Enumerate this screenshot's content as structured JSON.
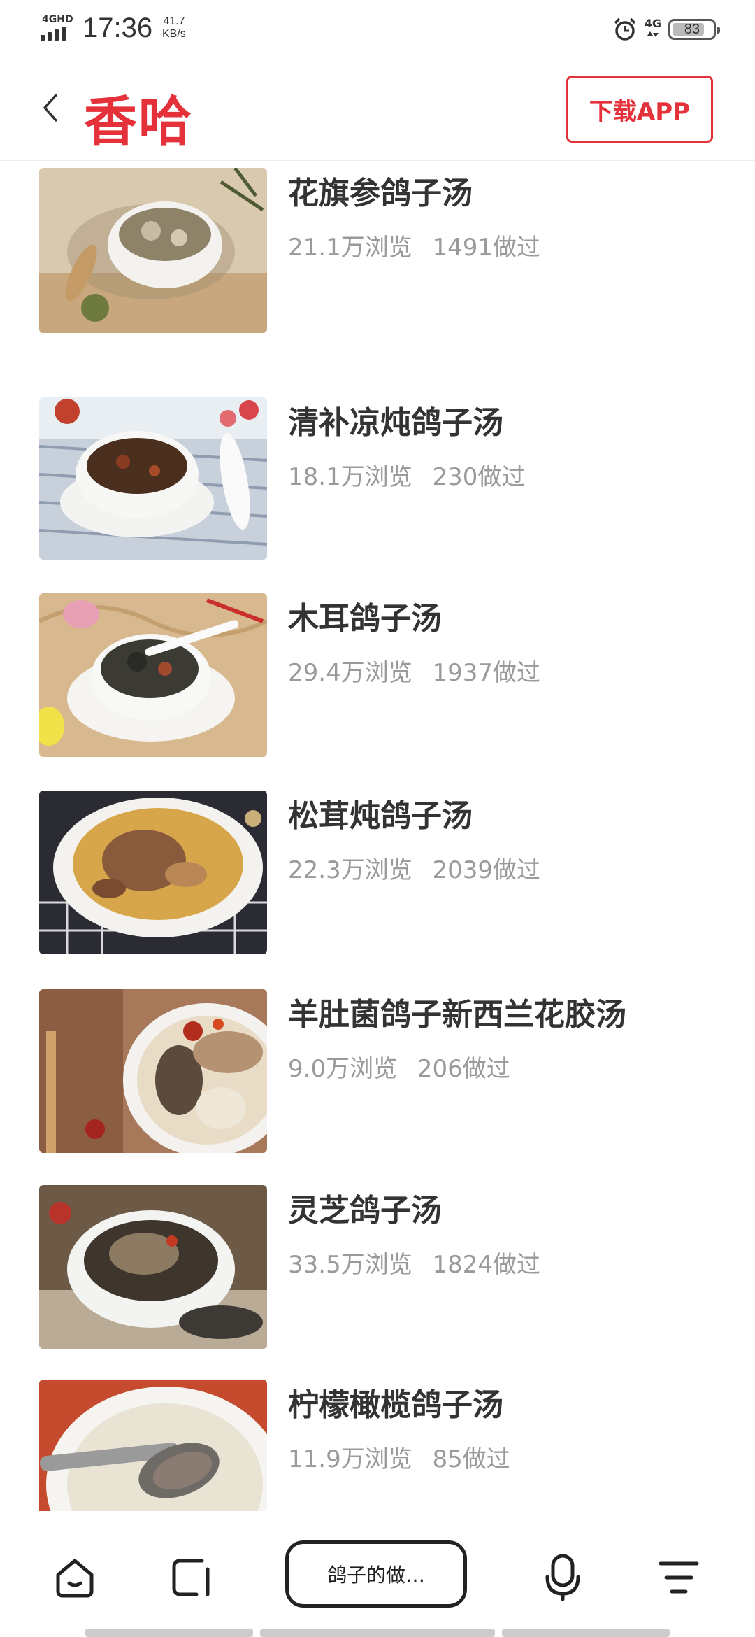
{
  "status_bar": {
    "network": "4GHD",
    "time": "17:36",
    "speed_value": "41.7",
    "speed_unit": "KB/s",
    "right_network": "4G",
    "battery": "83"
  },
  "header": {
    "logo": "香哈",
    "download_label": "下载APP"
  },
  "recipes": [
    {
      "title": "花旗参鸽子汤",
      "views": "21.1万浏览",
      "made": "1491做过"
    },
    {
      "title": "清补凉炖鸽子汤",
      "views": "18.1万浏览",
      "made": "230做过"
    },
    {
      "title": "木耳鸽子汤",
      "views": "29.4万浏览",
      "made": "1937做过"
    },
    {
      "title": "松茸炖鸽子汤",
      "views": "22.3万浏览",
      "made": "2039做过"
    },
    {
      "title": "羊肚菌鸽子新西兰花胶汤",
      "views": "9.0万浏览",
      "made": "206做过"
    },
    {
      "title": "灵芝鸽子汤",
      "views": "33.5万浏览",
      "made": "1824做过"
    },
    {
      "title": "柠檬橄榄鸽子汤",
      "views": "11.9万浏览",
      "made": "85做过"
    }
  ],
  "bottom_bar": {
    "search_label": "鸽子的做…",
    "icons": [
      "home-icon",
      "tabs-icon",
      "microphone-icon",
      "menu-icon"
    ]
  },
  "colors": {
    "brand": "#e5323a",
    "title": "#333333",
    "meta": "#9a9a9a"
  }
}
